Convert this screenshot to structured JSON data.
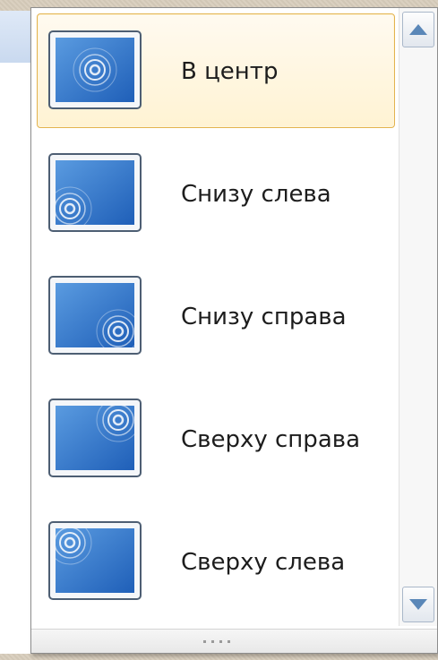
{
  "menu": {
    "items": [
      {
        "label": "В центр",
        "position": "center",
        "icon": "picture-center-icon",
        "selected": true
      },
      {
        "label": "Снизу слева",
        "position": "bottom-left",
        "icon": "picture-bottom-left-icon",
        "selected": false
      },
      {
        "label": "Снизу справа",
        "position": "bottom-right",
        "icon": "picture-bottom-right-icon",
        "selected": false
      },
      {
        "label": "Сверху справа",
        "position": "top-right",
        "icon": "picture-top-right-icon",
        "selected": false
      },
      {
        "label": "Сверху слева",
        "position": "top-left",
        "icon": "picture-top-left-icon",
        "selected": false
      }
    ]
  },
  "scrollbar": {
    "up_icon": "scroll-up-arrow-icon",
    "down_icon": "scroll-down-arrow-icon"
  },
  "colors": {
    "selected_border": "#e3b34e",
    "thumb_blue": "#2f6fc2",
    "arrow": "#5a87b8"
  }
}
